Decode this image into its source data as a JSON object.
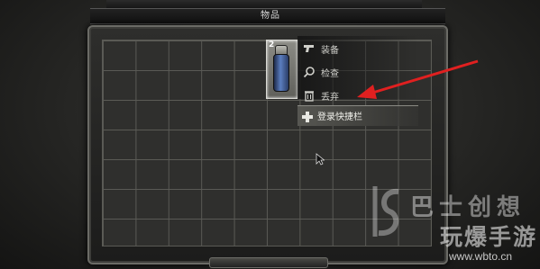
{
  "header": {
    "tab_title": "物品"
  },
  "inventory": {
    "grid": {
      "columns": 10,
      "rows": 7
    },
    "selected_item": {
      "count": "2",
      "icon": "grenade-icon"
    }
  },
  "context_menu": {
    "items": [
      {
        "label": "装备",
        "icon": "pistol-icon"
      },
      {
        "label": "检查",
        "icon": "magnifier-icon"
      },
      {
        "label": "丢弃",
        "icon": "trash-icon"
      }
    ],
    "submenu": {
      "label": "登录快捷栏",
      "icon": "dpad-icon"
    }
  },
  "annotation": {
    "arrow_color": "#e02020"
  },
  "watermark": {
    "title": "巴士创想",
    "subtitle": "玩爆手游",
    "url": "www.wbto.cn"
  }
}
